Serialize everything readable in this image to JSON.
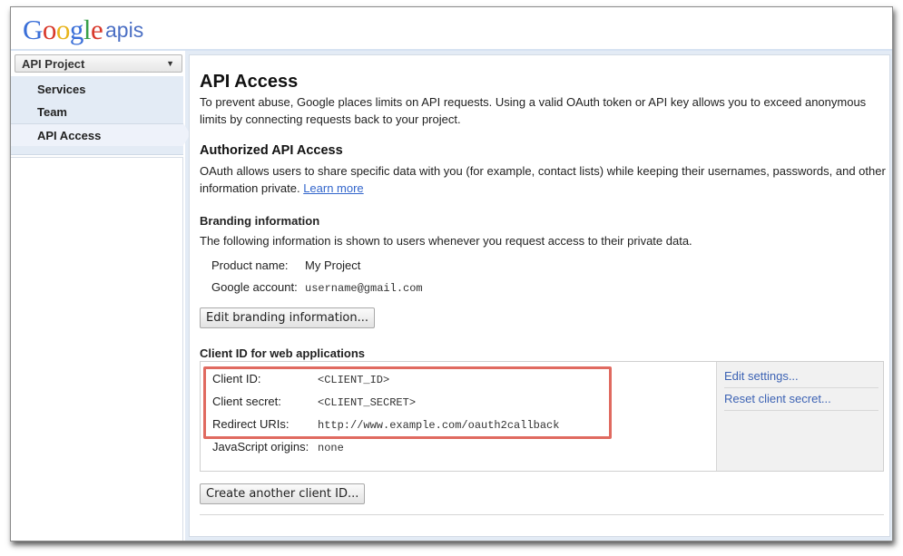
{
  "header": {
    "logo_letters": [
      "G",
      "o",
      "o",
      "g",
      "l",
      "e"
    ],
    "logo_suffix": "apis"
  },
  "sidebar": {
    "project_select": {
      "value": "API Project",
      "caret_icon": "▼"
    },
    "items": [
      {
        "label": "Services",
        "active": false
      },
      {
        "label": "Team",
        "active": false
      },
      {
        "label": "API Access",
        "active": true
      }
    ]
  },
  "main": {
    "title": "API Access",
    "intro": "To prevent abuse, Google places limits on API requests. Using a valid OAuth token or API key allows you to exceed anonymous limits by connecting requests back to your project.",
    "authorized": {
      "heading": "Authorized API Access",
      "text": "OAuth allows users to share specific data with you (for example, contact lists) while keeping their usernames, passwords, and other information private.",
      "learn_more": "Learn more"
    },
    "branding": {
      "heading": "Branding information",
      "text": "The following information is shown to users whenever you request access to their private data.",
      "product_name_label": "Product name:",
      "product_name_value": "My Project",
      "account_label": "Google account:",
      "account_value": "username@gmail.com",
      "edit_button": "Edit branding information..."
    },
    "client": {
      "heading": "Client ID for web applications",
      "rows": [
        {
          "label": "Client ID:",
          "value": "<CLIENT_ID>"
        },
        {
          "label": "Client secret:",
          "value": "<CLIENT_SECRET>"
        },
        {
          "label": "Redirect URIs:",
          "value": "http://www.example.com/oauth2callback"
        },
        {
          "label": "JavaScript origins:",
          "value": "none"
        }
      ],
      "actions": [
        "Edit settings...",
        "Reset client secret..."
      ],
      "highlight_color": "#e06a60",
      "create_button": "Create another client ID..."
    }
  }
}
